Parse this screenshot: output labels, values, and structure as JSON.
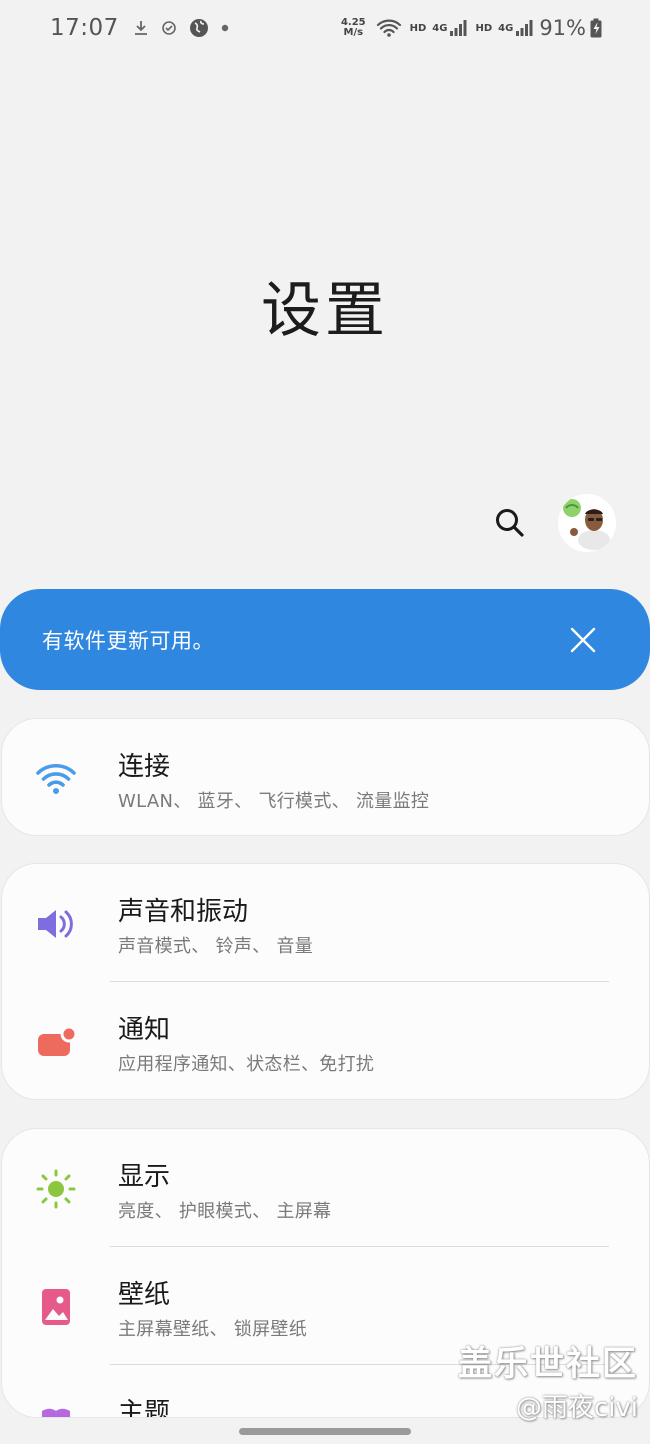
{
  "status_bar": {
    "time": "17:07",
    "net_speed_value": "4.25",
    "net_speed_unit": "M/s",
    "hd1": "HD",
    "net1": "4G",
    "hd2": "HD",
    "net2": "4G",
    "battery": "91%",
    "icons": [
      "download-icon",
      "check-circle-icon",
      "globe-icon",
      "dot-icon",
      "wifi-icon",
      "signal-icon",
      "battery-charging-icon"
    ]
  },
  "header": {
    "title": "设置"
  },
  "banner": {
    "text": "有软件更新可用。"
  },
  "groups": [
    {
      "items": [
        {
          "title": "连接",
          "subtitle": "WLAN、 蓝牙、 飞行模式、 流量监控",
          "icon": "wifi-icon",
          "color": "#4a9be8"
        }
      ]
    },
    {
      "items": [
        {
          "title": "声音和振动",
          "subtitle": "声音模式、 铃声、 音量",
          "icon": "speaker-icon",
          "color": "#7d6ee0"
        },
        {
          "title": "通知",
          "subtitle": "应用程序通知、状态栏、免打扰",
          "icon": "notification-icon",
          "color": "#ee6a5e"
        }
      ]
    },
    {
      "items": [
        {
          "title": "显示",
          "subtitle": "亮度、 护眼模式、 主屏幕",
          "icon": "sun-icon",
          "color": "#8cc63f"
        },
        {
          "title": "壁纸",
          "subtitle": "主屏幕壁纸、 锁屏壁纸",
          "icon": "wallpaper-icon",
          "color": "#e55a8a"
        },
        {
          "title": "主题",
          "subtitle": "",
          "icon": "theme-icon",
          "color": "#b469e0"
        }
      ]
    }
  ],
  "watermark": {
    "line1": "盖乐世社区",
    "line2": "@雨夜civi"
  }
}
